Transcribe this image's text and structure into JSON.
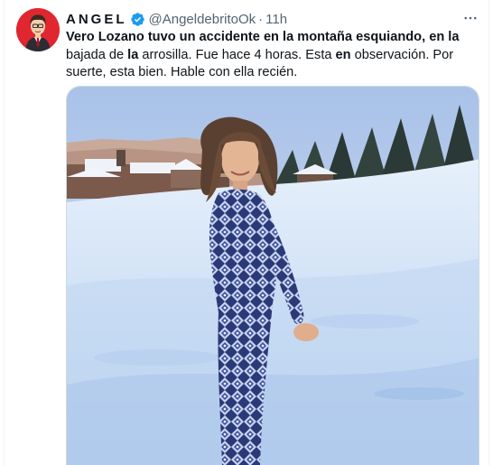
{
  "tweet": {
    "display_name": "ANGEL",
    "handle": "@AngeldebritoOk",
    "separator": "·",
    "time": "11h",
    "text_segments": [
      {
        "text": "Vero Lozano tuvo un accidente en la montaña esquiando, en la",
        "bold": true
      },
      {
        "text": " bajada de ",
        "bold": false
      },
      {
        "text": "la",
        "bold": true
      },
      {
        "text": " arrosilla. Fue hace 4 horas. Esta ",
        "bold": false
      },
      {
        "text": "en",
        "bold": true
      },
      {
        "text": " observación. Por suerte, esta bien. Hable con ella recién.",
        "bold": false
      }
    ],
    "avatar_icon": "cartoon-man-avatar",
    "verified_icon": "verified-badge-icon",
    "more_icon": "more-options-icon",
    "colors": {
      "verified": "#1d9bf0",
      "avatar_bg": "#e0272f",
      "handle": "#536471",
      "text": "#0f1419"
    }
  }
}
